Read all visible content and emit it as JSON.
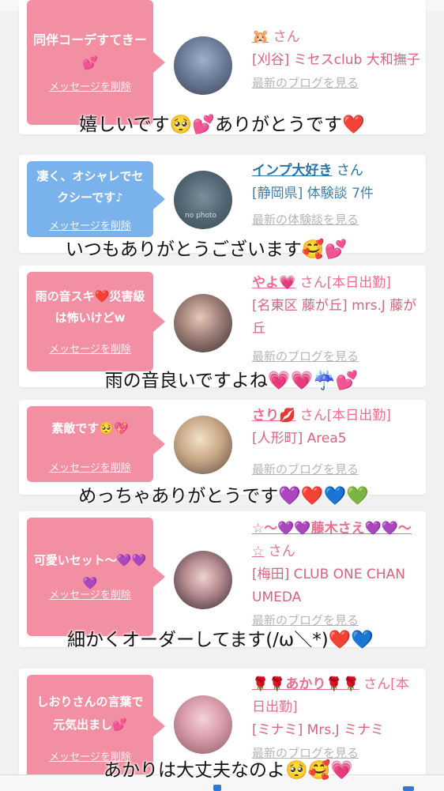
{
  "colors": {
    "bubble_pink": "#f38fa2",
    "bubble_blue": "#7ab2ec",
    "name_pink": "#e8708e",
    "name_blue": "#2773a8",
    "link_gray": "#b5b5b5"
  },
  "cards": [
    {
      "message": "同伴コーデすてきー💕",
      "delete_label": "メッセージを削除",
      "name": "🐹",
      "san": "さん",
      "location": "[刈谷] ミセスclub 大和撫子",
      "link": "最新のブログを見る",
      "caption": "嬉しいです🥺💕ありがとうです❤️"
    },
    {
      "message": "凄く、オシャレでセクシーです♪",
      "delete_label": "メッセージを削除",
      "name": "インプ大好き",
      "san": "さん",
      "location": "[静岡県] 体験談 7件",
      "link": "最新の体験談を見る",
      "avatar_text": "no photo",
      "caption": "いつもありがとうございます🥰💕"
    },
    {
      "message": "雨の音スキ❤️災害級は怖いけどw",
      "delete_label": "メッセージを削除",
      "name": "やよ💗",
      "san": "さん[本日出勤]",
      "location": "[名東区 藤が丘] mrs.J 藤が丘",
      "link": "最新のブログを見る",
      "caption": "雨の音良いですよね💗💗☔️💕"
    },
    {
      "message": "素敵です🥺💖",
      "delete_label": "メッセージを削除",
      "name": "さり💋",
      "san": "さん[本日出勤]",
      "location": "[人形町] Area5",
      "link": "最新のブログを見る",
      "caption": "めっちゃありがとうです💜❤️💙💚"
    },
    {
      "message": "可愛いセット〜💜💜💜",
      "delete_label": "メッセージを削除",
      "name": "☆〜💜💜藤木さえ💜💜〜☆",
      "san": "さん",
      "location": "[梅田] CLUB ONE CHAN UMEDA",
      "link": "最新のブログを見る",
      "caption": "細かくオーダーしてます(/ω＼*)❤️💙"
    },
    {
      "message": "しおりさんの言葉で元気出まし💕",
      "delete_label": "メッセージを削除",
      "name": "🌹🌹あかり🌹🌹",
      "san": "さん[本日出勤]",
      "location": "[ミナミ] Mrs.J ミナミ",
      "link": "最新のブログを見る",
      "caption": "あかりは大丈夫なのよ🥺🥰💗"
    }
  ]
}
